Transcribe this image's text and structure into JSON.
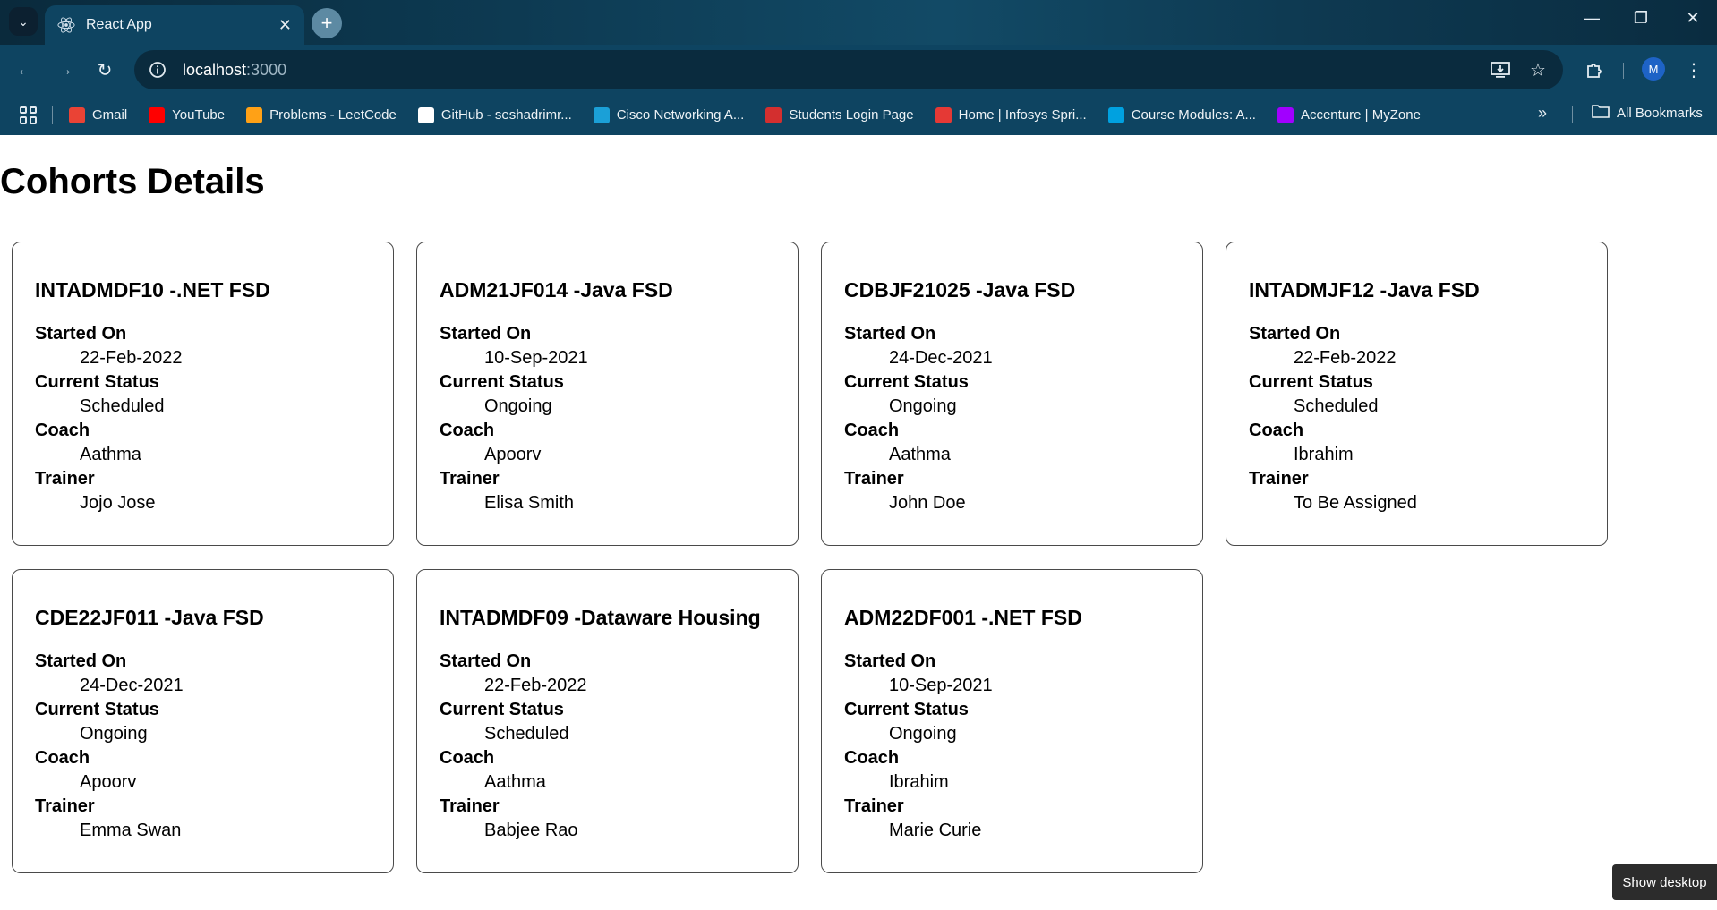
{
  "browser": {
    "tab_title": "React App",
    "url_host": "localhost",
    "url_port": ":3000",
    "profile_initial": "M",
    "bookmarks": [
      {
        "label": "Gmail",
        "icon": "gmail-icon",
        "color": "#ea4335"
      },
      {
        "label": "YouTube",
        "icon": "youtube-icon",
        "color": "#ff0000"
      },
      {
        "label": "Problems - LeetCode",
        "icon": "leetcode-icon",
        "color": "#ffa116"
      },
      {
        "label": "GitHub - seshadrimr...",
        "icon": "github-icon",
        "color": "#ffffff"
      },
      {
        "label": "Cisco Networking A...",
        "icon": "cisco-icon",
        "color": "#1ba0d7"
      },
      {
        "label": "Students Login Page",
        "icon": "students-icon",
        "color": "#d32f2f"
      },
      {
        "label": "Home | Infosys Spri...",
        "icon": "infosys-icon",
        "color": "#e53935"
      },
      {
        "label": "Course Modules: A...",
        "icon": "salesforce-icon",
        "color": "#00a1e0"
      },
      {
        "label": "Accenture | MyZone",
        "icon": "accenture-icon",
        "color": "#a100ff"
      }
    ],
    "all_bookmarks_label": "All Bookmarks"
  },
  "page": {
    "title": "Cohorts Details",
    "labels": {
      "started_on": "Started On",
      "current_status": "Current Status",
      "coach": "Coach",
      "trainer": "Trainer"
    },
    "cohorts": [
      {
        "title": "INTADMDF10 -.NET FSD",
        "started_on": "22-Feb-2022",
        "status": "Scheduled",
        "coach": "Aathma",
        "trainer": "Jojo Jose"
      },
      {
        "title": "ADM21JF014 -Java FSD",
        "started_on": "10-Sep-2021",
        "status": "Ongoing",
        "coach": "Apoorv",
        "trainer": "Elisa Smith"
      },
      {
        "title": "CDBJF21025 -Java FSD",
        "started_on": "24-Dec-2021",
        "status": "Ongoing",
        "coach": "Aathma",
        "trainer": "John Doe"
      },
      {
        "title": "INTADMJF12 -Java FSD",
        "started_on": "22-Feb-2022",
        "status": "Scheduled",
        "coach": "Ibrahim",
        "trainer": "To Be Assigned"
      },
      {
        "title": "CDE22JF011 -Java FSD",
        "started_on": "24-Dec-2021",
        "status": "Ongoing",
        "coach": "Apoorv",
        "trainer": "Emma Swan"
      },
      {
        "title": "INTADMDF09 -Dataware Housing",
        "started_on": "22-Feb-2022",
        "status": "Scheduled",
        "coach": "Aathma",
        "trainer": "Babjee Rao"
      },
      {
        "title": "ADM22DF001 -.NET FSD",
        "started_on": "10-Sep-2021",
        "status": "Ongoing",
        "coach": "Ibrahim",
        "trainer": "Marie Curie"
      }
    ]
  },
  "os": {
    "show_desktop_label": "Show desktop"
  }
}
